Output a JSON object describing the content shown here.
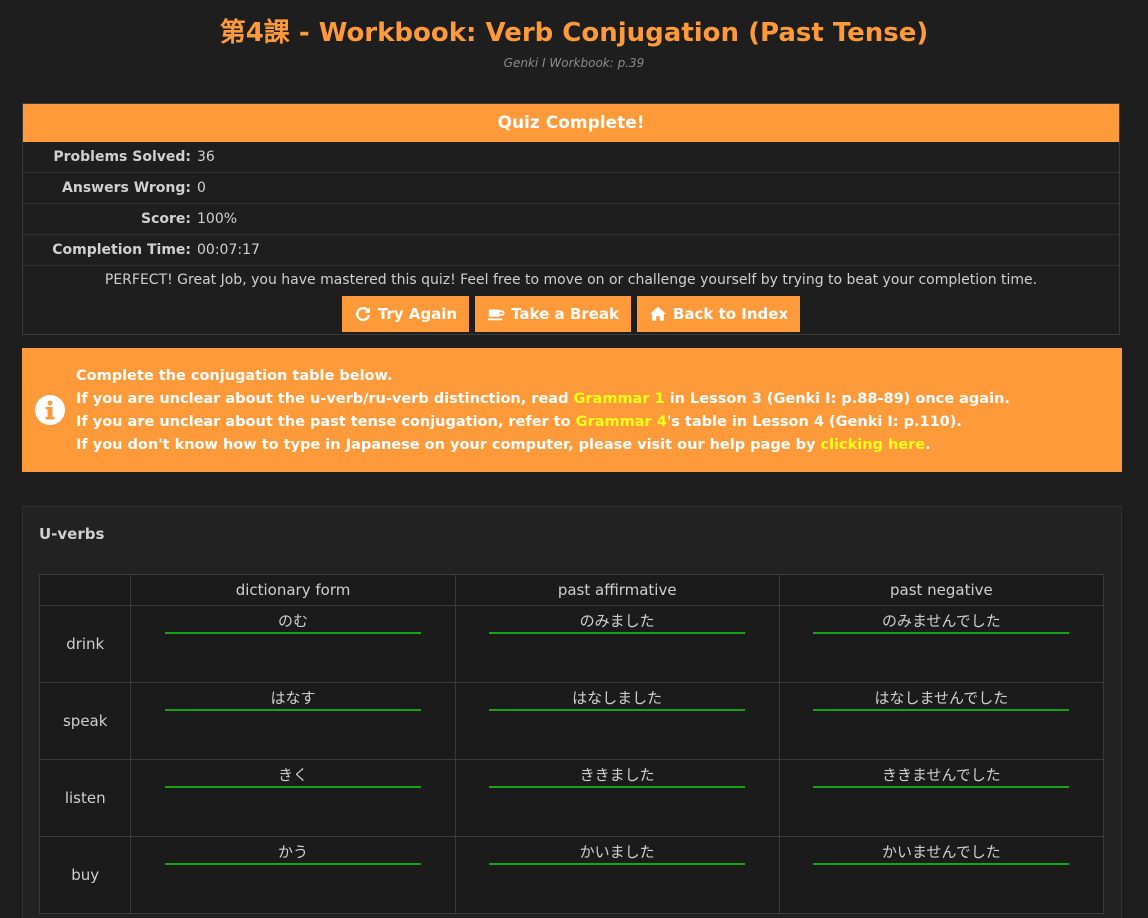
{
  "header": {
    "title": "第4課 - Workbook: Verb Conjugation (Past Tense)",
    "subtitle": "Genki I Workbook: p.39"
  },
  "results": {
    "heading": "Quiz Complete!",
    "stats": [
      {
        "label": "Problems Solved:",
        "value": "36"
      },
      {
        "label": "Answers Wrong:",
        "value": "0"
      },
      {
        "label": "Score:",
        "value": "100%"
      },
      {
        "label": "Completion Time:",
        "value": "00:07:17"
      }
    ],
    "message": "PERFECT! Great Job, you have mastered this quiz! Feel free to move on or challenge yourself by trying to beat your completion time.",
    "buttons": {
      "try_again": "Try Again",
      "take_break": "Take a Break",
      "back_index": "Back to Index"
    }
  },
  "info": {
    "line1": "Complete the conjugation table below.",
    "line2_pre": "If you are unclear about the u-verb/ru-verb distinction, read ",
    "line2_link": "Grammar 1",
    "line2_post": " in Lesson 3 (Genki I: p.88-89) once again.",
    "line3_pre": "If you are unclear about the past tense conjugation, refer to ",
    "line3_link": "Grammar 4",
    "line3_post": "'s table in Lesson 4 (Genki I: p.110).",
    "line4_pre": "If you don't know how to type in Japanese on your computer, please visit our help page by ",
    "line4_link": "clicking here",
    "line4_post": "."
  },
  "table": {
    "section": "U-verbs",
    "columns": [
      "",
      "dictionary form",
      "past affirmative",
      "past negative"
    ],
    "rows": [
      {
        "verb": "drink",
        "answers": [
          "のむ",
          "のみました",
          "のみませんでした"
        ]
      },
      {
        "verb": "speak",
        "answers": [
          "はなす",
          "はなしました",
          "はなしませんでした"
        ]
      },
      {
        "verb": "listen",
        "answers": [
          "きく",
          "ききました",
          "ききませんでした"
        ]
      },
      {
        "verb": "buy",
        "answers": [
          "かう",
          "かいました",
          "かいませんでした"
        ]
      }
    ]
  },
  "colors": {
    "accent": "#ff9a3a",
    "highlight": "#ffff1a",
    "underline": "#17a317",
    "background": "#1e1e1e"
  },
  "icons": {
    "try_again": "refresh-icon",
    "take_break": "coffee-icon",
    "back_index": "home-icon",
    "info": "info-icon"
  }
}
